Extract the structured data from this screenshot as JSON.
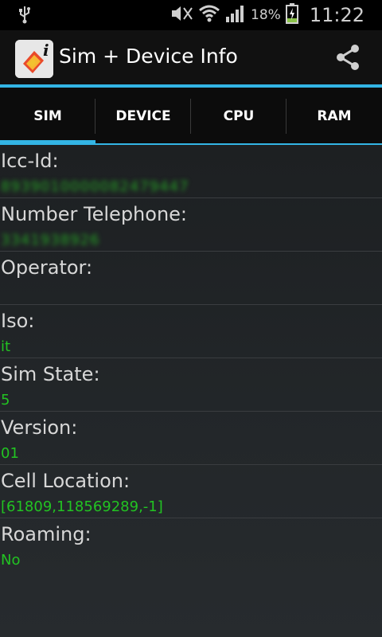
{
  "status": {
    "battery_percent": "18%",
    "time": "11:22",
    "icons": [
      "usb-icon",
      "mute-icon",
      "wifi-icon",
      "signal-icon",
      "battery-charging-icon"
    ]
  },
  "action_bar": {
    "title": "Sim + Device Info",
    "app_icon": "sim-info-app-icon",
    "share_icon": "share-icon"
  },
  "tabs": [
    {
      "label": "SIM",
      "active": true
    },
    {
      "label": "DEVICE",
      "active": false
    },
    {
      "label": "CPU",
      "active": false
    },
    {
      "label": "RAM",
      "active": false
    }
  ],
  "rows": [
    {
      "label": "Icc-Id:",
      "value": "8939010000082479447",
      "blurred": true
    },
    {
      "label": "Number Telephone:",
      "value": "3341938926",
      "blurred": true
    },
    {
      "label": "Operator:",
      "value": ""
    },
    {
      "label": "Iso:",
      "value": "it"
    },
    {
      "label": "Sim State:",
      "value": "5"
    },
    {
      "label": "Version:",
      "value": "01"
    },
    {
      "label": "Cell Location:",
      "value": "[61809,118569289,-1]"
    },
    {
      "label": "Roaming:",
      "value": "No"
    }
  ],
  "colors": {
    "accent": "#33b5e5",
    "value_green": "#22c322"
  }
}
